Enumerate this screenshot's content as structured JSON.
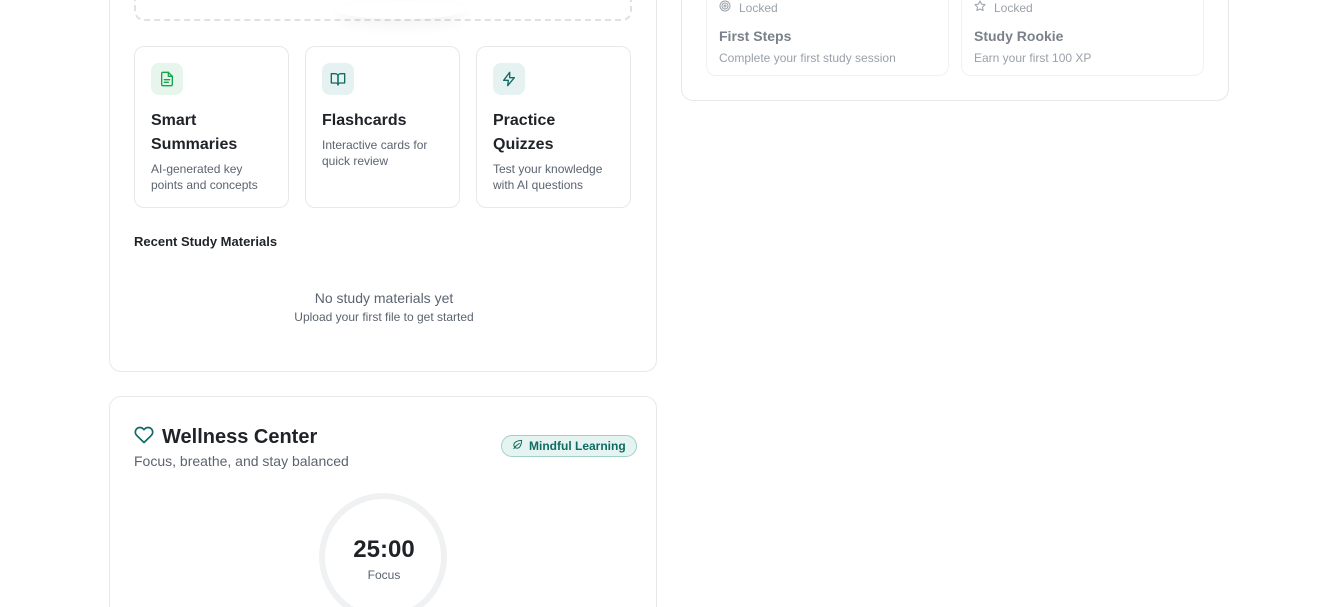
{
  "features": [
    {
      "title": "Smart Summaries",
      "desc": "AI-generated key points and concepts",
      "icon": "document-icon"
    },
    {
      "title": "Flashcards",
      "desc": "Interactive cards for quick review",
      "icon": "book-open-icon"
    },
    {
      "title": "Practice Quizzes",
      "desc": "Test your knowledge with AI questions",
      "icon": "lightning-icon"
    }
  ],
  "recent": {
    "title": "Recent Study Materials",
    "empty_title": "No study materials yet",
    "empty_sub": "Upload your first file to get started"
  },
  "achievements": [
    {
      "status": "Locked",
      "title": "First Steps",
      "desc": "Complete your first study session",
      "icon": "target-icon"
    },
    {
      "status": "Locked",
      "title": "Study Rookie",
      "desc": "Earn your first 100 XP",
      "icon": "star-icon"
    }
  ],
  "wellness": {
    "title": "Wellness Center",
    "subtitle": "Focus, breathe, and stay balanced",
    "badge": "Mindful Learning",
    "timer": "25:00",
    "timer_label": "Focus"
  },
  "colors": {
    "accent_teal": "#0f6b63",
    "accent_green": "#16a34a"
  }
}
